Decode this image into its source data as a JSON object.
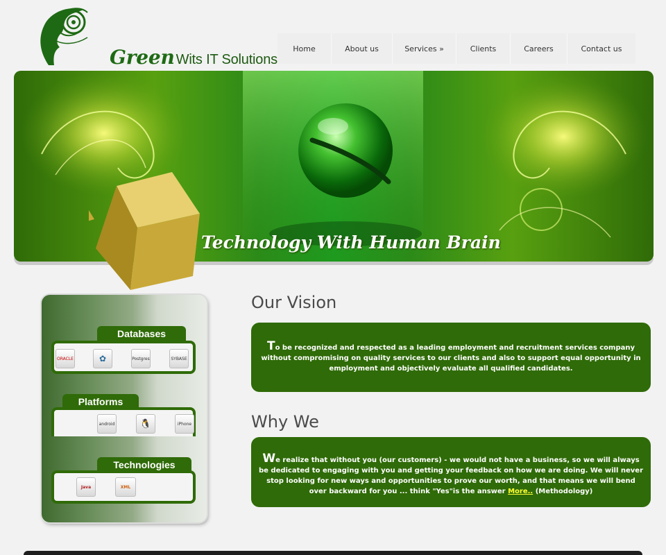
{
  "logo": {
    "script_text": "Green",
    "company": "Wits IT Solutions SDN. BHD."
  },
  "nav": {
    "items": [
      {
        "label": "Home"
      },
      {
        "label": "About us"
      },
      {
        "label": "Services »"
      },
      {
        "label": "Clients"
      },
      {
        "label": "Careers"
      },
      {
        "label": "Contact us"
      }
    ]
  },
  "banner": {
    "tagline": "Technology With Human Brain"
  },
  "tech_panel": {
    "databases": {
      "title": "Databases",
      "logos": [
        {
          "icon": "oracle-logo-icon",
          "label": "ORACLE"
        },
        {
          "icon": "mysql-logo-icon",
          "label": ""
        },
        {
          "icon": "postgres-logo-icon",
          "label": "Postgres"
        },
        {
          "icon": "sybase-logo-icon",
          "label": "SYBASE"
        }
      ]
    },
    "platforms": {
      "title": "Platforms",
      "logos": [
        {
          "icon": "android-logo-icon",
          "label": "android"
        },
        {
          "icon": "linux-logo-icon",
          "label": ""
        },
        {
          "icon": "iphone-logo-icon",
          "label": "iPhone"
        }
      ]
    },
    "technologies": {
      "title": "Technologies",
      "logos": [
        {
          "icon": "java-logo-icon",
          "label": "Java"
        },
        {
          "icon": "xml-logo-icon",
          "label": "XML"
        }
      ]
    }
  },
  "vision": {
    "heading": "Our Vision",
    "first_letter": "T",
    "text": "o be recognized and respected as a leading employment and recruitment services company without compromising on quality services to our clients and also to support equal opportunity in employment and objectively evaluate all qualified candidates."
  },
  "why_we": {
    "heading": "Why We",
    "first_letter": "W",
    "text": "e realize that without you (our customers) - we would not have a business, so we will always be dedicated to engaging with you and getting your feedback on how we are doing. We will never stop looking for new ways and opportunities to prove our worth, and that means we will bend over backward for you ... think \"Yes\"is the answer",
    "more_link": "More..",
    "suffix": "(Methodology)"
  },
  "colors": {
    "brand_green": "#2f6b08",
    "link_yellow": "#ffff33"
  }
}
